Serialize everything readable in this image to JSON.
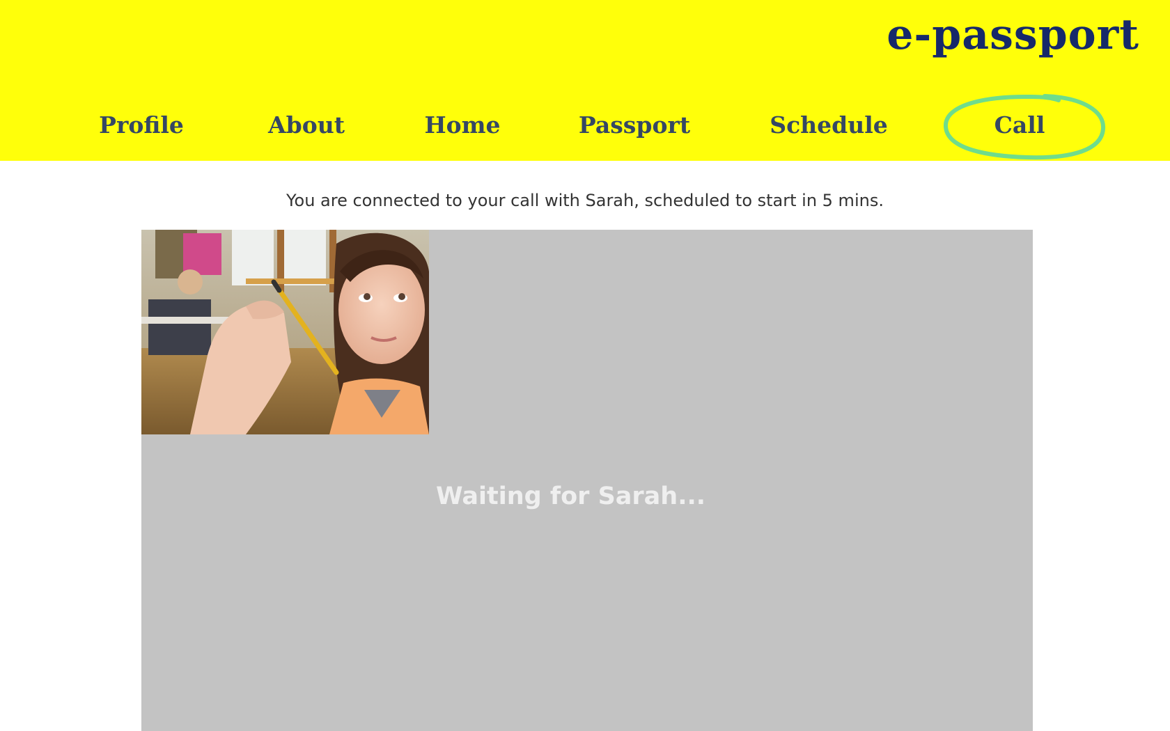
{
  "app": {
    "logo": "e-passport"
  },
  "nav": {
    "items": [
      {
        "label": "Profile"
      },
      {
        "label": "About"
      },
      {
        "label": "Home"
      },
      {
        "label": "Passport"
      },
      {
        "label": "Schedule"
      },
      {
        "label": "Call"
      }
    ],
    "active": "Call"
  },
  "call": {
    "status_message": "You are connected to your call with Sarah, scheduled to start in 5 mins.",
    "waiting_message": "Waiting for Sarah..."
  },
  "colors": {
    "header_bg": "#ffff0a",
    "logo": "#16296a",
    "nav_text": "#354764",
    "active_highlight": "#6fdc8c",
    "video_bg": "#c3c3c3"
  }
}
